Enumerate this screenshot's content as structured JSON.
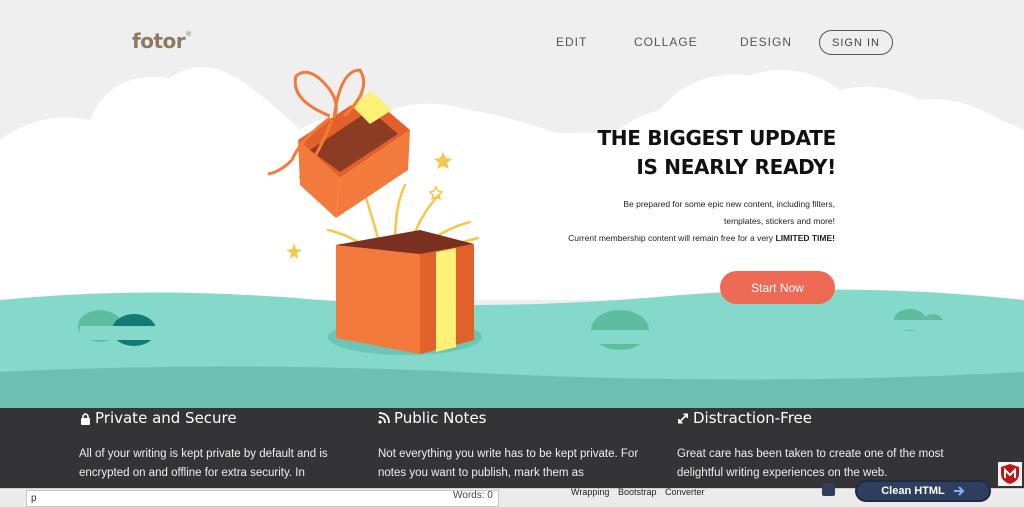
{
  "header": {
    "logo_text": "fotor",
    "logo_mark": "®",
    "nav": [
      "EDIT",
      "COLLAGE",
      "DESIGN"
    ],
    "signin_label": "SIGN IN"
  },
  "hero": {
    "headline_line1": "THE BIGGEST UPDATE",
    "headline_line2": "IS NEARLY READY!",
    "sub_line1": "Be prepared for some epic new content, including filters,",
    "sub_line2": "templates, stickers and more!",
    "sub_line3_prefix": "Current membership content will remain free for a very ",
    "sub_line3_bold": "LIMITED TIME!",
    "cta_label": "Start Now",
    "colors": {
      "accent": "#ee6a54",
      "ground": "#80d6c8",
      "box": "#f27a3c",
      "ribbon": "#fdf176"
    }
  },
  "features": [
    {
      "icon": "lock-icon",
      "title": "Private and Secure",
      "text": "All of your writing is kept private by default and is encrypted on and offline for extra security. In"
    },
    {
      "icon": "rss-icon",
      "title": "Public Notes",
      "text": "Not everything you write has to be kept private. For notes you want to publish, mark them as"
    },
    {
      "icon": "expand-icon",
      "title": "Distraction-Free",
      "text": "Great care has been taken to create one of the most delightful writing experiences on the web."
    }
  ],
  "editor": {
    "input_value": "p",
    "word_count": "Words: 0",
    "tools": [
      "Wrapping",
      "Bootstrap",
      "Converter"
    ],
    "action_label": "Clean HTML"
  }
}
